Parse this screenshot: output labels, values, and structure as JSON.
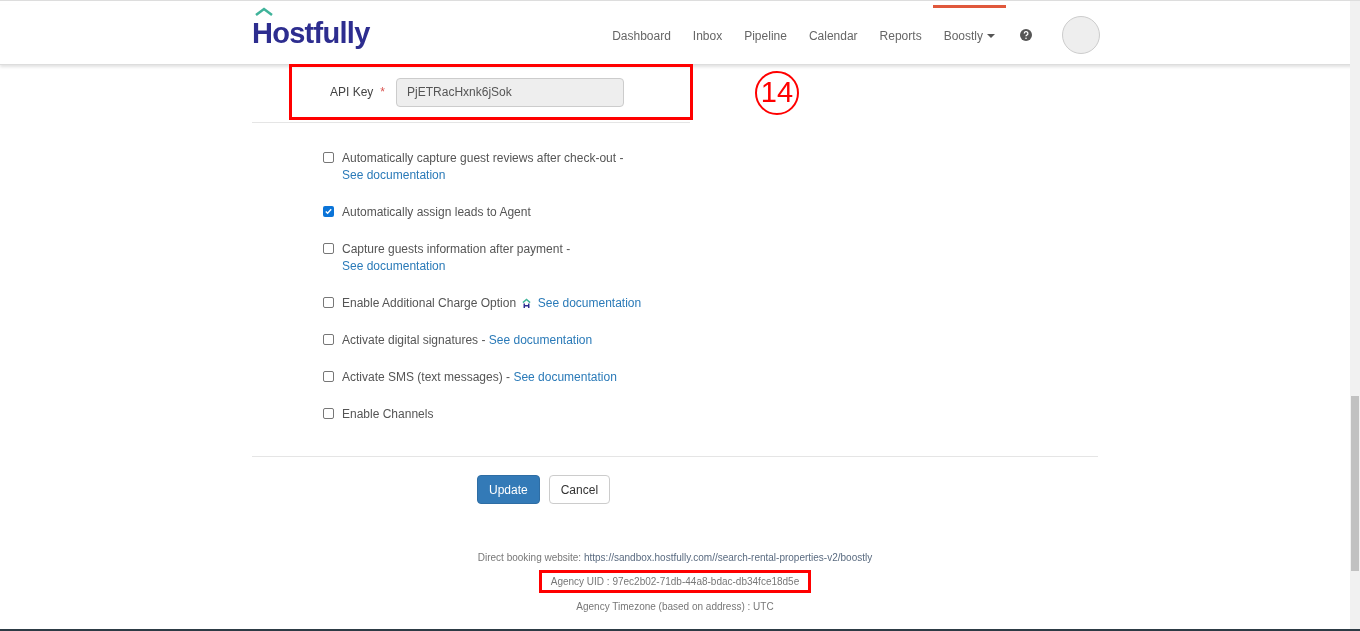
{
  "header": {
    "logo": "Hostfully",
    "nav": [
      {
        "label": "Dashboard",
        "selected": false,
        "dropdown": false
      },
      {
        "label": "Inbox",
        "selected": false,
        "dropdown": false
      },
      {
        "label": "Pipeline",
        "selected": false,
        "dropdown": false
      },
      {
        "label": "Calendar",
        "selected": false,
        "dropdown": false
      },
      {
        "label": "Reports",
        "selected": false,
        "dropdown": false
      },
      {
        "label": "Boostly",
        "selected": true,
        "dropdown": true
      }
    ]
  },
  "api_key": {
    "label": "API Key",
    "required_mark": "*",
    "value": "PjETRacHxnk6jSok",
    "disabled": true
  },
  "step_badge": "14",
  "options": [
    {
      "label": "Automatically capture guest reviews after check-out",
      "kind": "dash_link",
      "link": "See documentation",
      "checked": false
    },
    {
      "label": "Automatically assign leads to Agent",
      "kind": "plain",
      "checked": true
    },
    {
      "label": "Capture guests information after payment",
      "kind": "dash_link",
      "link": "See documentation",
      "checked": false
    },
    {
      "label": "Enable Additional Charge Option",
      "kind": "icon_link",
      "link": "See documentation",
      "checked": false
    },
    {
      "label": "Activate digital signatures",
      "kind": "dash_link",
      "link": "See documentation",
      "checked": false
    },
    {
      "label": "Activate SMS (text messages)",
      "kind": "dash_link",
      "link": "See documentation",
      "checked": false
    },
    {
      "label": "Enable Channels",
      "kind": "plain",
      "checked": false
    }
  ],
  "separator": "-",
  "buttons": {
    "primary": "Update",
    "secondary": "Cancel"
  },
  "footer": {
    "booking_label": "Direct booking website:",
    "booking_url": "https://sandbox.hostfully.com//search-rental-properties-v2/boostly",
    "agency_uid": "Agency UID : 97ec2b02-71db-44a8-bdac-db34fce18d5e",
    "timezone": "Agency Timezone (based on address) : UTC"
  }
}
